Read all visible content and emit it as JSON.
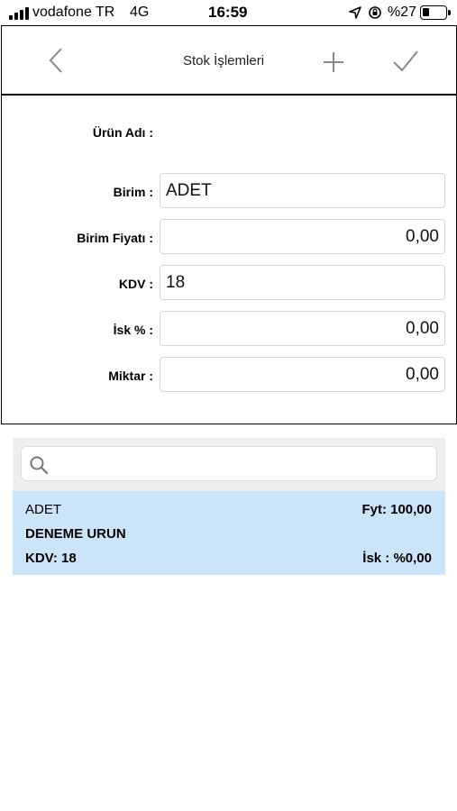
{
  "status_bar": {
    "carrier": "vodafone TR",
    "network": "4G",
    "time": "16:59",
    "battery_percent": "%27",
    "battery_level": 0.27
  },
  "nav": {
    "title": "Stok İşlemleri",
    "icons": [
      "chevron-left-icon",
      "plus-icon",
      "checkmark-icon"
    ]
  },
  "form": {
    "product_name": {
      "label": "Ürün Adı :",
      "value": ""
    },
    "unit": {
      "label": "Birim :",
      "value": "ADET"
    },
    "unit_price": {
      "label": "Birim Fiyatı :",
      "value": "0,00"
    },
    "vat": {
      "label": "KDV :",
      "value": "18"
    },
    "discount": {
      "label": "İsk % :",
      "value": "0,00"
    },
    "quantity": {
      "label": "Miktar :",
      "value": "0,00"
    }
  },
  "search": {
    "placeholder": "",
    "icon": "search-icon"
  },
  "results": [
    {
      "unit": "ADET",
      "price": "Fyt: 100,00",
      "name": "DENEME URUN",
      "vat": "KDV: 18",
      "discount": "İsk : %0,00"
    }
  ],
  "colors": {
    "selected_row_bg": "#cce4fa",
    "search_panel_bg": "#eeeeee"
  }
}
